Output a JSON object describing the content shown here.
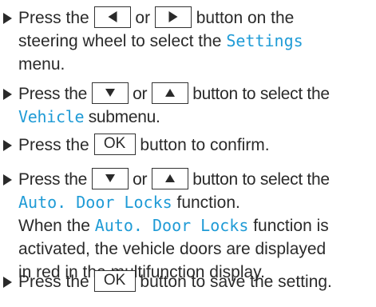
{
  "steps": [
    {
      "line1_a": "Press the ",
      "line1_b": " or ",
      "line1_c": " button on the",
      "line2_a": "steering wheel to select the ",
      "line2_disp": "Settings",
      "line3": "menu."
    },
    {
      "line1_a": "Press the ",
      "line1_b": " or ",
      "line1_c": " button to select the",
      "line2_disp": "Vehicle",
      "line2_b": " submenu."
    },
    {
      "line1_a": "Press the ",
      "key_label": "OK",
      "line1_b": " button to confirm."
    },
    {
      "line1_a": "Press the ",
      "line1_b": " or ",
      "line1_c": " button to select the",
      "line2_disp": "Auto. Door Locks",
      "line2_b": " function.",
      "line3_a": "When the ",
      "line3_disp": "Auto. Door Locks",
      "line3_b": " function is",
      "line4": "activated, the vehicle doors are displayed",
      "line5": "in red in the multifunction display."
    },
    {
      "line1_a": "Press the ",
      "key_label": "OK",
      "line1_b": " button to save the setting."
    }
  ],
  "colors": {
    "display_text": "#1f9bd6",
    "body_text": "#2a2a2a"
  },
  "icons": [
    "step-arrow-icon",
    "left-arrow-key-icon",
    "right-arrow-key-icon",
    "down-arrow-key-icon",
    "up-arrow-key-icon"
  ]
}
